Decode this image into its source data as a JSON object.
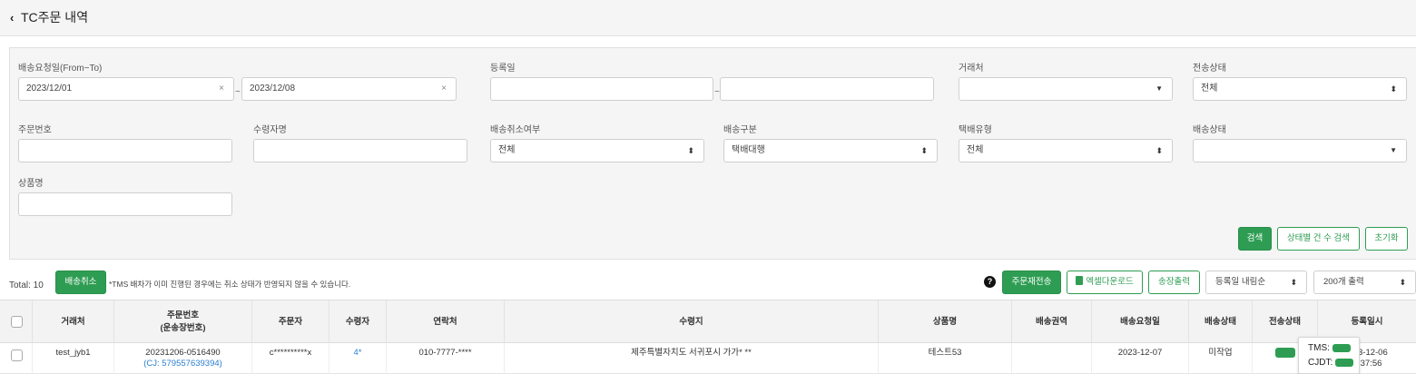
{
  "header": {
    "back_icon": "chevron-left-icon",
    "title": "TC주문 내역"
  },
  "filters": {
    "delivery_request_date": {
      "label": "배송요청일(From~To)",
      "from": "2023/12/01",
      "to": "2023/12/08",
      "tilde": "~",
      "clear": "×"
    },
    "registration_date": {
      "label": "등록일",
      "from": "",
      "to": "",
      "tilde": "~"
    },
    "client": {
      "label": "거래처",
      "value": ""
    },
    "transmission_status": {
      "label": "전송상태",
      "value": "전체"
    },
    "order_number": {
      "label": "주문번호",
      "value": ""
    },
    "recipient_name": {
      "label": "수령자명",
      "value": ""
    },
    "delivery_cancel": {
      "label": "배송취소여부",
      "value": "전체"
    },
    "delivery_type": {
      "label": "배송구분",
      "value": "택배대행"
    },
    "courier_type": {
      "label": "택배유형",
      "value": "전체"
    },
    "delivery_status": {
      "label": "배송상태",
      "value": ""
    },
    "product_name": {
      "label": "상품명",
      "value": ""
    },
    "buttons": {
      "search": "검색",
      "status_count_search": "상태별 건 수 검색",
      "reset": "초기화"
    }
  },
  "toolbar": {
    "total": "Total: 10",
    "cancel_delivery": "배송취소",
    "notice": "*TMS 배차가 이미 진행된 경우에는 취소 상태가 반영되지 않을 수 있습니다.",
    "help_icon": "?",
    "resend_order": "주문재전송",
    "excel_download": "엑셀다운로드",
    "print_invoice": "송장출력",
    "sort": "등록일 내림순",
    "page_size": "200개 출력"
  },
  "table": {
    "headers": [
      "거래처",
      "주문번호\n(운송장번호)",
      "주문자",
      "수령자",
      "연락처",
      "수령지",
      "상품명",
      "배송권역",
      "배송요청일",
      "배송상태",
      "전송상태",
      "등록일시"
    ],
    "rows": [
      {
        "client": "test_jyb1",
        "order_no": "20231206-0516490",
        "tracking_no": "(CJ: 579557639394)",
        "orderer": "c**********x",
        "recipient": "4*",
        "phone": "010-7777-****",
        "address": "제주특별자치도 서귀포시 가가* **",
        "product": "테스트53",
        "zone": "",
        "request_date": "2023-12-07",
        "delivery_status": "미작업",
        "registered_date": "3-12-06",
        "registered_time": ":37:56"
      }
    ]
  },
  "tooltip": {
    "tms": "TMS:",
    "cjdt": "CJDT:"
  },
  "colors": {
    "green": "#2e9d53",
    "link": "#2b7fd0"
  }
}
